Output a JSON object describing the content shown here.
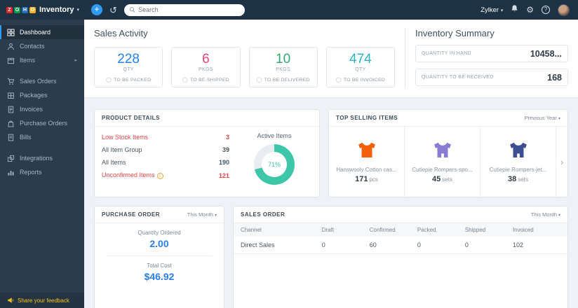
{
  "colors": {
    "accent": "#2a7de1",
    "alert": "#e84545"
  },
  "topbar": {
    "logo_letters": [
      {
        "ch": "Z",
        "color": "#e42527"
      },
      {
        "ch": "O",
        "color": "#089949"
      },
      {
        "ch": "H",
        "color": "#226db4"
      },
      {
        "ch": "O",
        "color": "#f9b21d"
      }
    ],
    "product_name": "Inventory",
    "search_placeholder": "Search",
    "org_name": "Zylker"
  },
  "sidebar": {
    "items": [
      {
        "label": "Dashboard"
      },
      {
        "label": "Contacts"
      },
      {
        "label": "Items"
      },
      {
        "label": "Sales Orders"
      },
      {
        "label": "Packages"
      },
      {
        "label": "Invoices"
      },
      {
        "label": "Purchase Orders"
      },
      {
        "label": "Bills"
      },
      {
        "label": "Integrations"
      },
      {
        "label": "Reports"
      }
    ],
    "feedback_label": "Share your feedback"
  },
  "sales_activity": {
    "title": "Sales Activity",
    "stats": [
      {
        "value": "228",
        "unit": "Qty",
        "label": "TO BE PACKED",
        "color": "#2382ed"
      },
      {
        "value": "6",
        "unit": "Pkgs",
        "label": "TO BE SHIPPED",
        "color": "#e8427c"
      },
      {
        "value": "10",
        "unit": "Pkgs",
        "label": "TO BE DELIVERED",
        "color": "#35a871"
      },
      {
        "value": "474",
        "unit": "Qty",
        "label": "TO BE INVOICED",
        "color": "#2bb3c0"
      }
    ]
  },
  "inventory_summary": {
    "title": "Inventory Summary",
    "rows": [
      {
        "label": "QUANTITY IN HAND",
        "value": "10458..."
      },
      {
        "label": "QUANTITY TO BE RECEIVED",
        "value": "168"
      }
    ]
  },
  "product_details": {
    "title": "PRODUCT DETAILS",
    "rows": [
      {
        "label": "Low Stock Items",
        "value": "3",
        "color": "#e84545"
      },
      {
        "label": "All Item Group",
        "value": "39"
      },
      {
        "label": "All Items",
        "value": "190"
      },
      {
        "label": "Unconfirmed Items",
        "value": "121",
        "color": "#e84545"
      }
    ],
    "donut": {
      "label": "Active Items",
      "percent": 71,
      "percent_label": "71%",
      "color": "#3ec6a8",
      "track": "#e9edf1"
    }
  },
  "top_selling": {
    "title": "TOP SELLING ITEMS",
    "range_label": "Previous Year",
    "items": [
      {
        "name": "Hanswooly Cotton cas...",
        "qty": "171",
        "unit": "pcs",
        "color": "#f2600a"
      },
      {
        "name": "Cutiepie Rompers-spo...",
        "qty": "45",
        "unit": "sets",
        "color": "#8a7bd3"
      },
      {
        "name": "Cutiepie Rompers-jet...",
        "qty": "38",
        "unit": "sets",
        "color": "#3d4f91"
      }
    ]
  },
  "purchase_order": {
    "title": "PURCHASE ORDER",
    "range_label": "This Month",
    "qty_label": "Quantity Ordered",
    "qty_value": "2.00",
    "cost_label": "Total Cost",
    "cost_value": "$46.92"
  },
  "sales_order": {
    "title": "SALES ORDER",
    "range_label": "This Month",
    "columns": [
      "Channel",
      "Draft",
      "Confirmed",
      "Packed",
      "Shipped",
      "Invoiced"
    ],
    "rows": [
      [
        "Direct Sales",
        "0",
        "60",
        "0",
        "0",
        "102"
      ]
    ]
  }
}
